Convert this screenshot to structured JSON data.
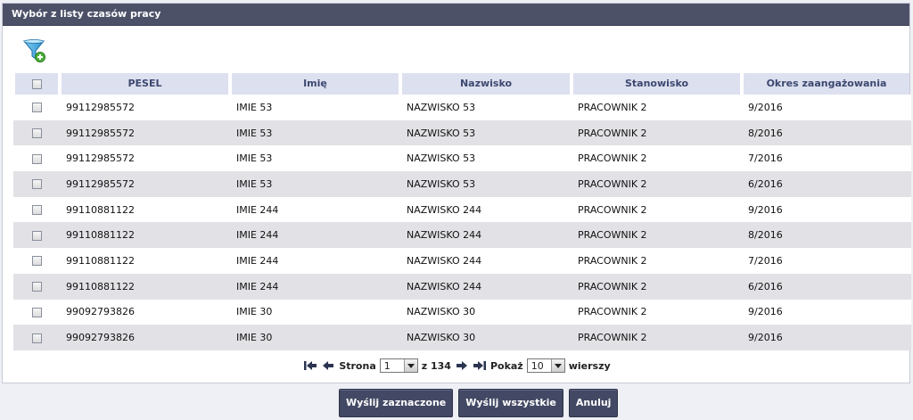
{
  "panel": {
    "title": "Wybór z listy czasów pracy"
  },
  "table": {
    "columns": [
      "PESEL",
      "Imię",
      "Nazwisko",
      "Stanowisko",
      "Okres zaangażowania"
    ],
    "rows": [
      [
        "99112985572",
        "IMIE 53",
        "NAZWISKO 53",
        "PRACOWNIK 2",
        "9/2016"
      ],
      [
        "99112985572",
        "IMIE 53",
        "NAZWISKO 53",
        "PRACOWNIK 2",
        "8/2016"
      ],
      [
        "99112985572",
        "IMIE 53",
        "NAZWISKO 53",
        "PRACOWNIK 2",
        "7/2016"
      ],
      [
        "99112985572",
        "IMIE 53",
        "NAZWISKO 53",
        "PRACOWNIK 2",
        "6/2016"
      ],
      [
        "99110881122",
        "IMIE 244",
        "NAZWISKO 244",
        "PRACOWNIK 2",
        "9/2016"
      ],
      [
        "99110881122",
        "IMIE 244",
        "NAZWISKO 244",
        "PRACOWNIK 2",
        "8/2016"
      ],
      [
        "99110881122",
        "IMIE 244",
        "NAZWISKO 244",
        "PRACOWNIK 2",
        "7/2016"
      ],
      [
        "99110881122",
        "IMIE 244",
        "NAZWISKO 244",
        "PRACOWNIK 2",
        "6/2016"
      ],
      [
        "99092793826",
        "IMIE 30",
        "NAZWISKO 30",
        "PRACOWNIK 2",
        "9/2016"
      ],
      [
        "99092793826",
        "IMIE 30",
        "NAZWISKO 30",
        "PRACOWNIK 2",
        "9/2016"
      ]
    ]
  },
  "pager": {
    "page_label": "Strona",
    "page_value": "1",
    "of_label": "z 134",
    "show_label": "Pokaż",
    "rows_value": "10",
    "rows_label": "wierszy"
  },
  "buttons": {
    "send_selected": "Wyślij zaznaczone",
    "send_all": "Wyślij wszystkie",
    "cancel": "Anuluj"
  },
  "colors": {
    "header_bg": "#4d5168",
    "button_bg": "#434964",
    "column_header_bg": "#dde0ef"
  }
}
